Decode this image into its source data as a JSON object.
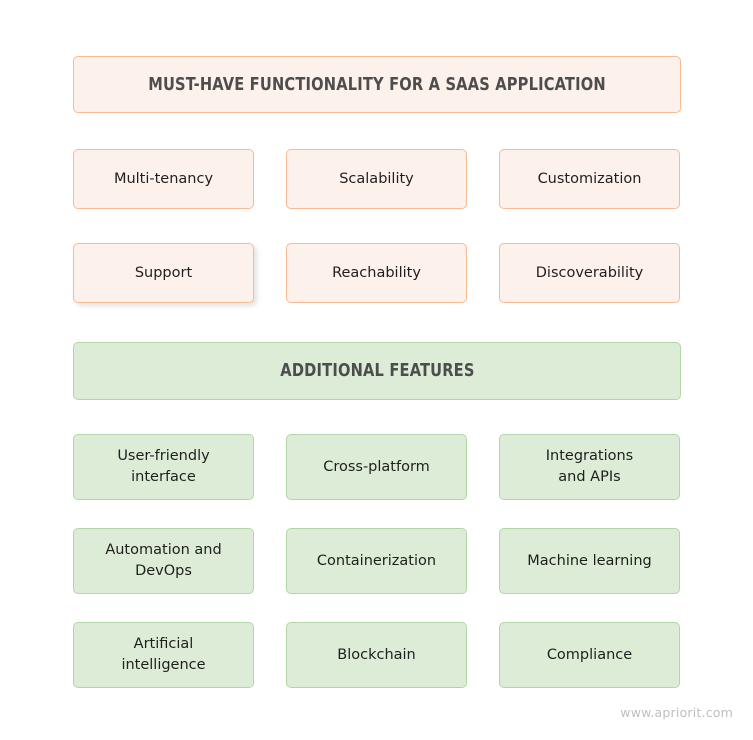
{
  "sections": {
    "must_have": {
      "banner_title": "MUST-HAVE FUNCTIONALITY FOR A SAAS APPLICATION",
      "cards": [
        {
          "label": "Multi-tenancy"
        },
        {
          "label": "Scalability"
        },
        {
          "label": "Customization"
        },
        {
          "label": "Support"
        },
        {
          "label": "Reachability"
        },
        {
          "label": "Discoverability"
        }
      ]
    },
    "additional": {
      "banner_title": "ADDITIONAL FEATURES",
      "cards": [
        {
          "label": "User-friendly\ninterface"
        },
        {
          "label": "Cross-platform"
        },
        {
          "label": "Integrations\nand APIs"
        },
        {
          "label": "Automation and\nDevOps"
        },
        {
          "label": "Containerization"
        },
        {
          "label": "Machine learning"
        },
        {
          "label": "Artificial\nintelligence"
        },
        {
          "label": "Blockchain"
        },
        {
          "label": "Compliance"
        }
      ]
    }
  },
  "watermark": "www.apriorit.com",
  "colors": {
    "orange_fill": "#fdf1ec",
    "orange_border": "#f7bb94",
    "green_fill": "#ddecd6",
    "green_border": "#b2d7a7",
    "banner_text": "#4d4d4d",
    "card_text": "#1f1f1f",
    "watermark_text": "#bfbfbf",
    "background": "#ffffff"
  }
}
